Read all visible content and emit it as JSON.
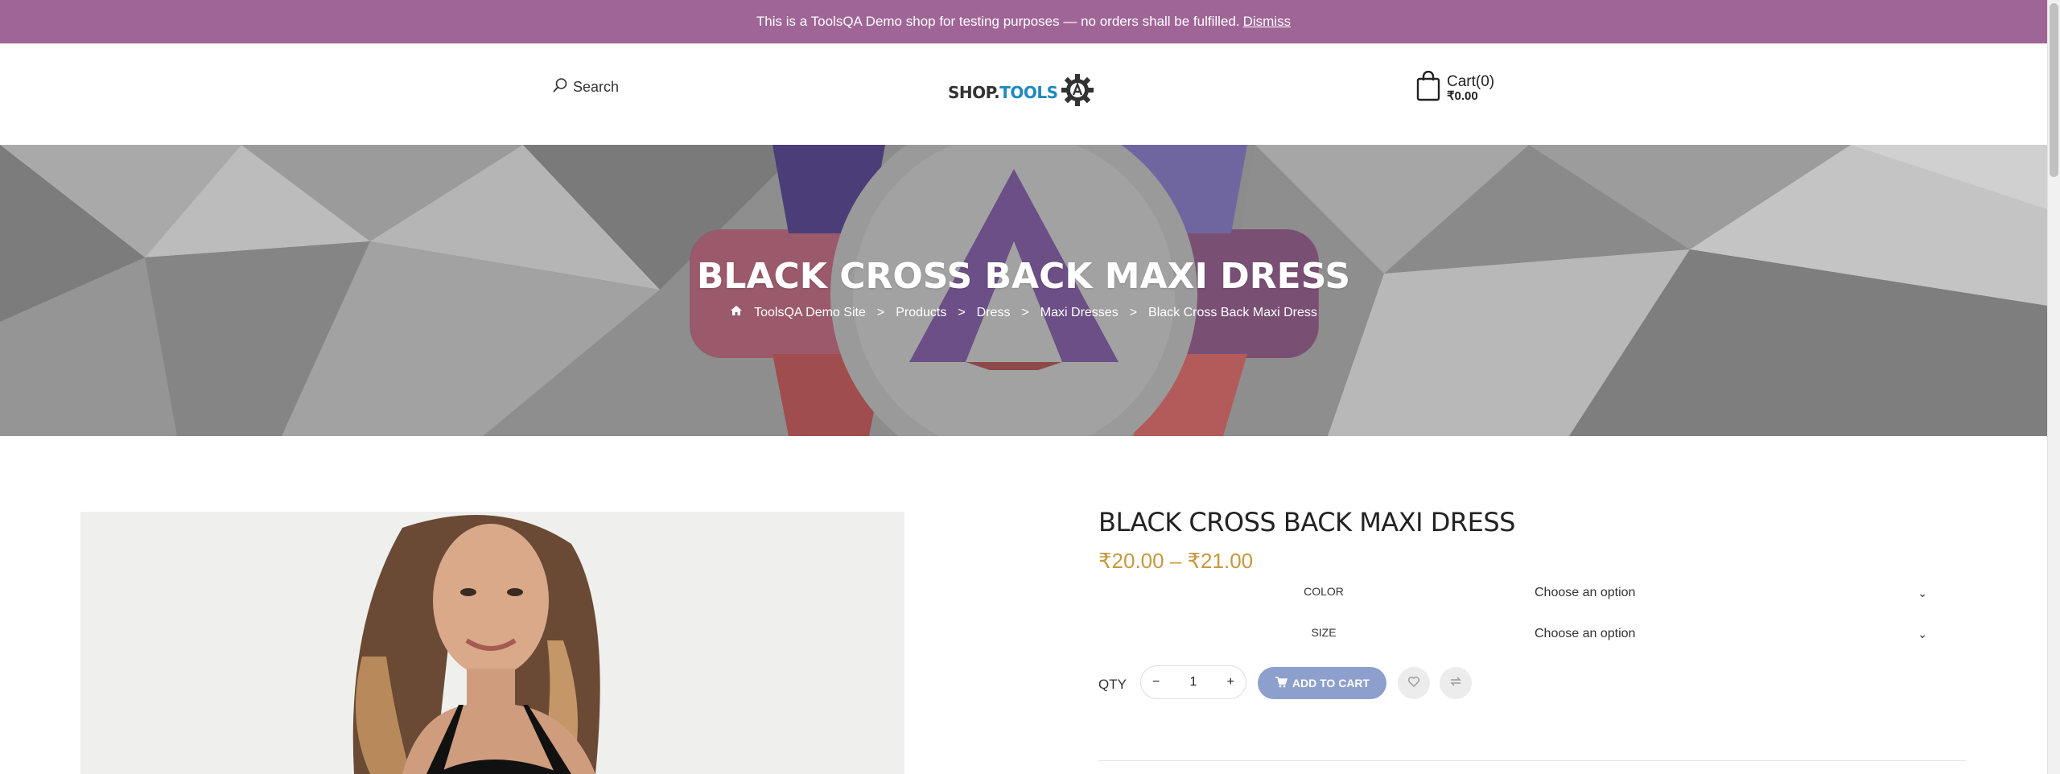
{
  "notice": {
    "text": "This is a ToolsQA Demo shop for testing purposes — no orders shall be fulfilled.",
    "dismiss": "Dismiss",
    "bg_color": "#a06597"
  },
  "header": {
    "search_label": "Search",
    "logo": {
      "part1": "SHOP.",
      "part2": "TOOLS"
    },
    "cart": {
      "title": "Cart(0)",
      "total": "₹0.00"
    }
  },
  "hero": {
    "title": "BLACK CROSS BACK MAXI DRESS",
    "breadcrumb": [
      "ToolsQA Demo Site",
      "Products",
      "Dress",
      "Maxi Dresses",
      "Black Cross Back Maxi Dress"
    ],
    "separator": ">"
  },
  "product": {
    "title": "BLACK CROSS BACK MAXI DRESS",
    "price": "₹20.00 – ₹21.00",
    "price_color": "#c59a3d",
    "options": [
      {
        "label": "COLOR",
        "value": "Choose an option"
      },
      {
        "label": "SIZE",
        "value": "Choose an option"
      }
    ],
    "qty_label": "QTY",
    "qty_value": "1",
    "qty_minus": "−",
    "qty_plus": "+",
    "add_to_cart": "ADD TO CART",
    "add_to_cart_color": "#8d9fcc"
  },
  "icons": {
    "search": "search-icon",
    "cart": "cart-bag-icon",
    "home": "home-icon",
    "wishlist": "heart-icon",
    "compare": "compare-icon",
    "chevron": "chevron-down-icon"
  }
}
